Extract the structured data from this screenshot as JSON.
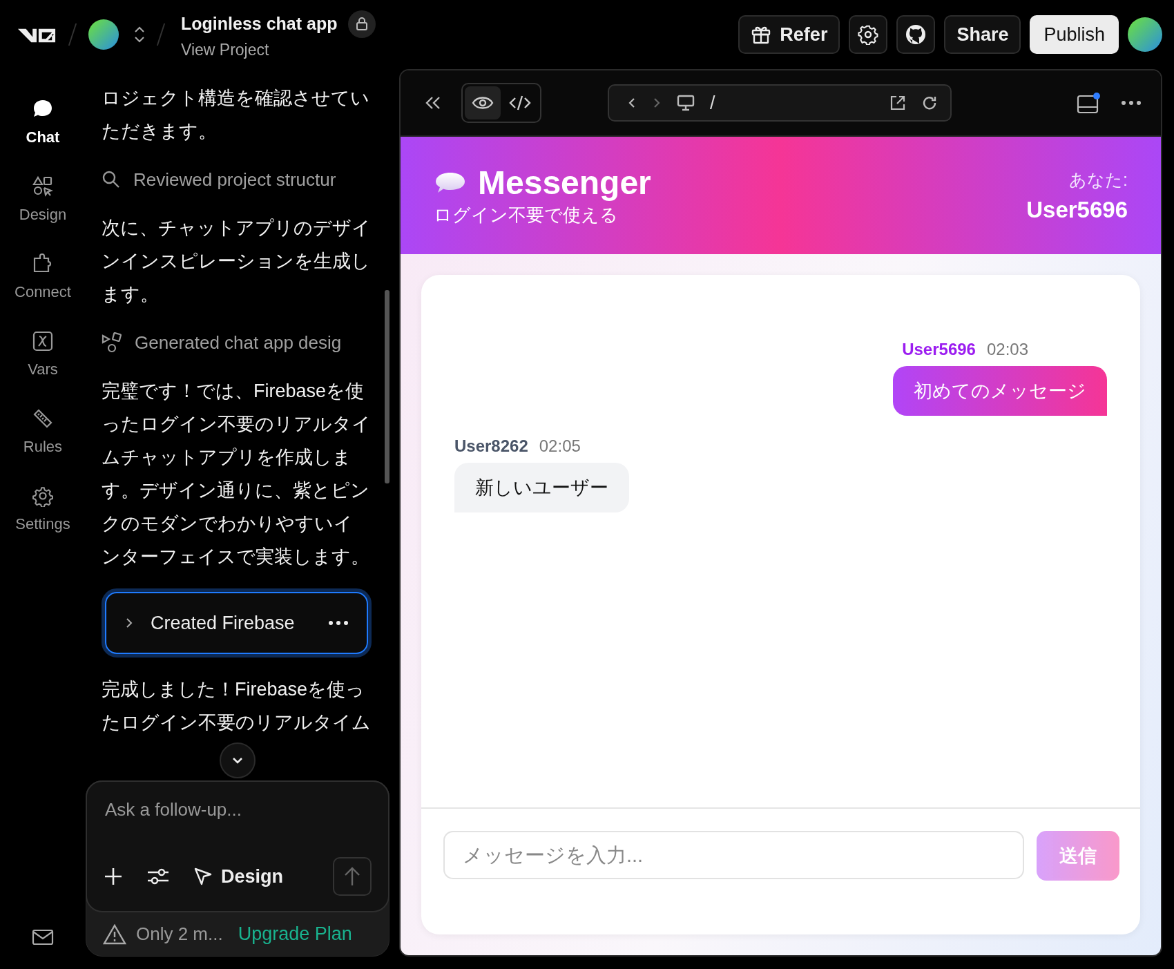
{
  "topbar": {
    "project_title": "Loginless chat app",
    "project_link": "View Project",
    "locked": true,
    "actions": [
      {
        "kind": "refer",
        "label": "Refer"
      },
      {
        "kind": "settings"
      },
      {
        "kind": "github"
      },
      {
        "kind": "share",
        "label": "Share"
      },
      {
        "kind": "publish",
        "label": "Publish"
      }
    ]
  },
  "nav": {
    "items": [
      {
        "kind": "chat",
        "label": "Chat",
        "selected": true
      },
      {
        "kind": "design",
        "label": "Design",
        "selected": false
      },
      {
        "kind": "connect",
        "label": "Connect",
        "selected": false
      },
      {
        "kind": "vars",
        "label": "Vars",
        "selected": false
      },
      {
        "kind": "rules",
        "label": "Rules",
        "selected": false
      },
      {
        "kind": "settings",
        "label": "Settings",
        "selected": false
      }
    ]
  },
  "chat": {
    "messages": [
      {
        "kind": "paragraph",
        "text": "ロジェクト構造を確認させていただきます。"
      },
      {
        "kind": "review",
        "text": "Reviewed project structur"
      },
      {
        "kind": "paragraph",
        "text": "次に、チャットアプリのデザインインスピレーションを生成します。"
      },
      {
        "kind": "generate",
        "text": "Generated chat app desig"
      },
      {
        "kind": "paragraph",
        "text": "完璧です！では、Firebaseを使ったログイン不要のリアルタイムチャットアプリを作成します。デザイン通りに、紫とピンクのモダンでわかりやすいインターフェイスで実装します。"
      },
      {
        "kind": "task",
        "text": "Created Firebase",
        "expanded": false
      },
      {
        "kind": "paragraph",
        "text": "完成しました！Firebaseを使ったログイン不要のリアルタイム"
      }
    ]
  },
  "composer": {
    "placeholder": "Ask a follow-up...",
    "mode": "Design",
    "notice": "Only 2 m...",
    "upgrade": "Upgrade Plan"
  },
  "preview": {
    "path": "/",
    "modes": [
      {
        "kind": "preview",
        "selected": true
      },
      {
        "kind": "code",
        "selected": false
      }
    ],
    "app": {
      "title": "Messenger",
      "subtitle": "ログイン不要で使える",
      "you_label": "あなた:",
      "current_user": "User5696",
      "messages": [
        {
          "user": "User5696",
          "time": "02:03",
          "text": "初めてのメッセージ",
          "own": true
        },
        {
          "user": "User8262",
          "time": "02:05",
          "text": "新しいユーザー",
          "own": false
        }
      ],
      "input_placeholder": "メッセージを入力...",
      "send": {
        "label": "送信",
        "disabled": true
      }
    }
  }
}
